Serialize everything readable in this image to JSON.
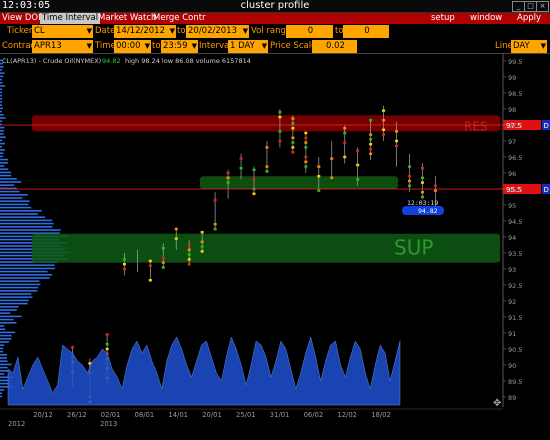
{
  "window": {
    "clock": "12:03:05",
    "title": "cluster profile"
  },
  "menu": {
    "tabs": [
      "View DOM",
      "Time Interval",
      "Market Watch",
      "Merge Contr"
    ],
    "right": [
      "setup",
      "window",
      "Apply"
    ]
  },
  "controls": {
    "ticker_label": "Ticker",
    "ticker": "CL",
    "date_label": "Date",
    "date_from": "14/12/2012",
    "date_to_label": "to",
    "date_to": "20/02/2013",
    "vol_range_label": "Vol range",
    "vol_from": "0",
    "vol_to_label": "to",
    "vol_to": "0",
    "contract_label": "Contract",
    "contract": "APR13",
    "time_label": "Time",
    "time_from": "00:00",
    "time_to_label": "to",
    "time_to": "23:59",
    "interval_label": "Interval",
    "interval": "1 DAY",
    "price_scale_label": "Price Scale",
    "price_scale": "0.02",
    "line_label": "Line",
    "line": "DAY"
  },
  "chart_data": {
    "type": "line",
    "instrument": "CL(APR13) - Crude Oil(NYMEX)",
    "last_price": "94.82",
    "stats": "high 98.24   low 86.08   volume 6157814",
    "y_ticks": [
      "99.5",
      "99",
      "98.5",
      "98",
      "97.5",
      "97",
      "96.5",
      "96",
      "95.5",
      "95",
      "94.5",
      "94",
      "93.5",
      "93",
      "92.5",
      "92",
      "91.5",
      "91",
      "90.5",
      "90",
      "89.5",
      "89"
    ],
    "x_ticks": [
      "20/12",
      "26/12",
      "02/01",
      "08/01",
      "14/01",
      "20/01",
      "25/01",
      "31/01",
      "06/02",
      "12/02",
      "18/02"
    ],
    "year_labels": [
      "2012",
      "2013"
    ],
    "zones": [
      {
        "label": "RES",
        "from": 97.3,
        "to": 97.8,
        "color": "#8b0000"
      },
      {
        "label": "",
        "from": 95.5,
        "to": 95.9,
        "color": "#0f5a0f"
      },
      {
        "label": "SUP",
        "from": 93.2,
        "to": 94.1,
        "color": "#0e5a14"
      }
    ],
    "lines": [
      {
        "price": 97.5,
        "label": "97.5",
        "tag": "D",
        "color": "#ff2020"
      },
      {
        "price": 95.5,
        "label": "95.5",
        "tag": "D",
        "color": "#ff2020"
      }
    ],
    "price_callout": {
      "time": "12:03:19",
      "price": "94.82"
    },
    "volume_series": [
      0.45,
      0.4,
      0.6,
      0.2,
      0.35,
      0.5,
      0.6,
      0.45,
      0.3,
      0.15,
      0.25,
      0.75,
      0.7,
      0.65,
      0.55,
      0.5,
      0.4,
      0.55,
      0.6,
      0.7,
      0.65,
      0.45,
      0.35,
      0.2,
      0.5,
      0.7,
      0.8,
      0.65,
      0.75,
      0.55,
      0.4,
      0.2,
      0.55,
      0.75,
      0.85,
      0.7,
      0.5,
      0.35,
      0.55,
      0.75,
      0.8,
      0.6,
      0.4,
      0.3,
      0.6,
      0.85,
      0.7,
      0.5,
      0.25,
      0.5,
      0.8,
      0.75,
      0.6,
      0.35,
      0.55,
      0.8,
      0.7,
      0.45,
      0.2,
      0.4,
      0.65,
      0.85,
      0.6,
      0.3,
      0.55,
      0.75,
      0.8,
      0.5,
      0.35,
      0.6,
      0.8,
      0.7,
      0.4,
      0.2,
      0.5,
      0.75,
      0.65,
      0.3,
      0.55,
      0.8
    ],
    "candles": [
      {
        "x": 0.08,
        "lo": 89.3,
        "hi": 90.6
      },
      {
        "x": 0.12,
        "lo": 88.8,
        "hi": 90.2
      },
      {
        "x": 0.16,
        "lo": 89.4,
        "hi": 91.0
      },
      {
        "x": 0.2,
        "lo": 92.8,
        "hi": 93.5
      },
      {
        "x": 0.23,
        "lo": 92.9,
        "hi": 93.6
      },
      {
        "x": 0.26,
        "lo": 92.6,
        "hi": 93.3
      },
      {
        "x": 0.29,
        "lo": 93.0,
        "hi": 93.8
      },
      {
        "x": 0.32,
        "lo": 93.6,
        "hi": 94.3
      },
      {
        "x": 0.35,
        "lo": 93.1,
        "hi": 93.9
      },
      {
        "x": 0.38,
        "lo": 93.5,
        "hi": 94.2
      },
      {
        "x": 0.41,
        "lo": 94.2,
        "hi": 95.4
      },
      {
        "x": 0.44,
        "lo": 95.2,
        "hi": 96.1
      },
      {
        "x": 0.47,
        "lo": 95.8,
        "hi": 96.6
      },
      {
        "x": 0.5,
        "lo": 95.3,
        "hi": 96.2
      },
      {
        "x": 0.53,
        "lo": 96.0,
        "hi": 97.0
      },
      {
        "x": 0.56,
        "lo": 96.8,
        "hi": 98.0
      },
      {
        "x": 0.59,
        "lo": 96.6,
        "hi": 97.8
      },
      {
        "x": 0.62,
        "lo": 96.0,
        "hi": 97.3
      },
      {
        "x": 0.65,
        "lo": 95.4,
        "hi": 96.5
      },
      {
        "x": 0.68,
        "lo": 95.8,
        "hi": 97.0
      },
      {
        "x": 0.71,
        "lo": 96.3,
        "hi": 97.5
      },
      {
        "x": 0.74,
        "lo": 95.6,
        "hi": 96.8
      },
      {
        "x": 0.77,
        "lo": 96.4,
        "hi": 97.7
      },
      {
        "x": 0.8,
        "lo": 97.0,
        "hi": 98.1
      },
      {
        "x": 0.83,
        "lo": 96.2,
        "hi": 97.6
      },
      {
        "x": 0.86,
        "lo": 95.4,
        "hi": 96.6
      },
      {
        "x": 0.89,
        "lo": 95.2,
        "hi": 96.3
      },
      {
        "x": 0.92,
        "lo": 94.8,
        "hi": 95.9
      }
    ]
  },
  "colors": {
    "accent": "#b00000",
    "field": "#ffa500",
    "label": "#ff9900",
    "volume": "#1e50d0"
  }
}
